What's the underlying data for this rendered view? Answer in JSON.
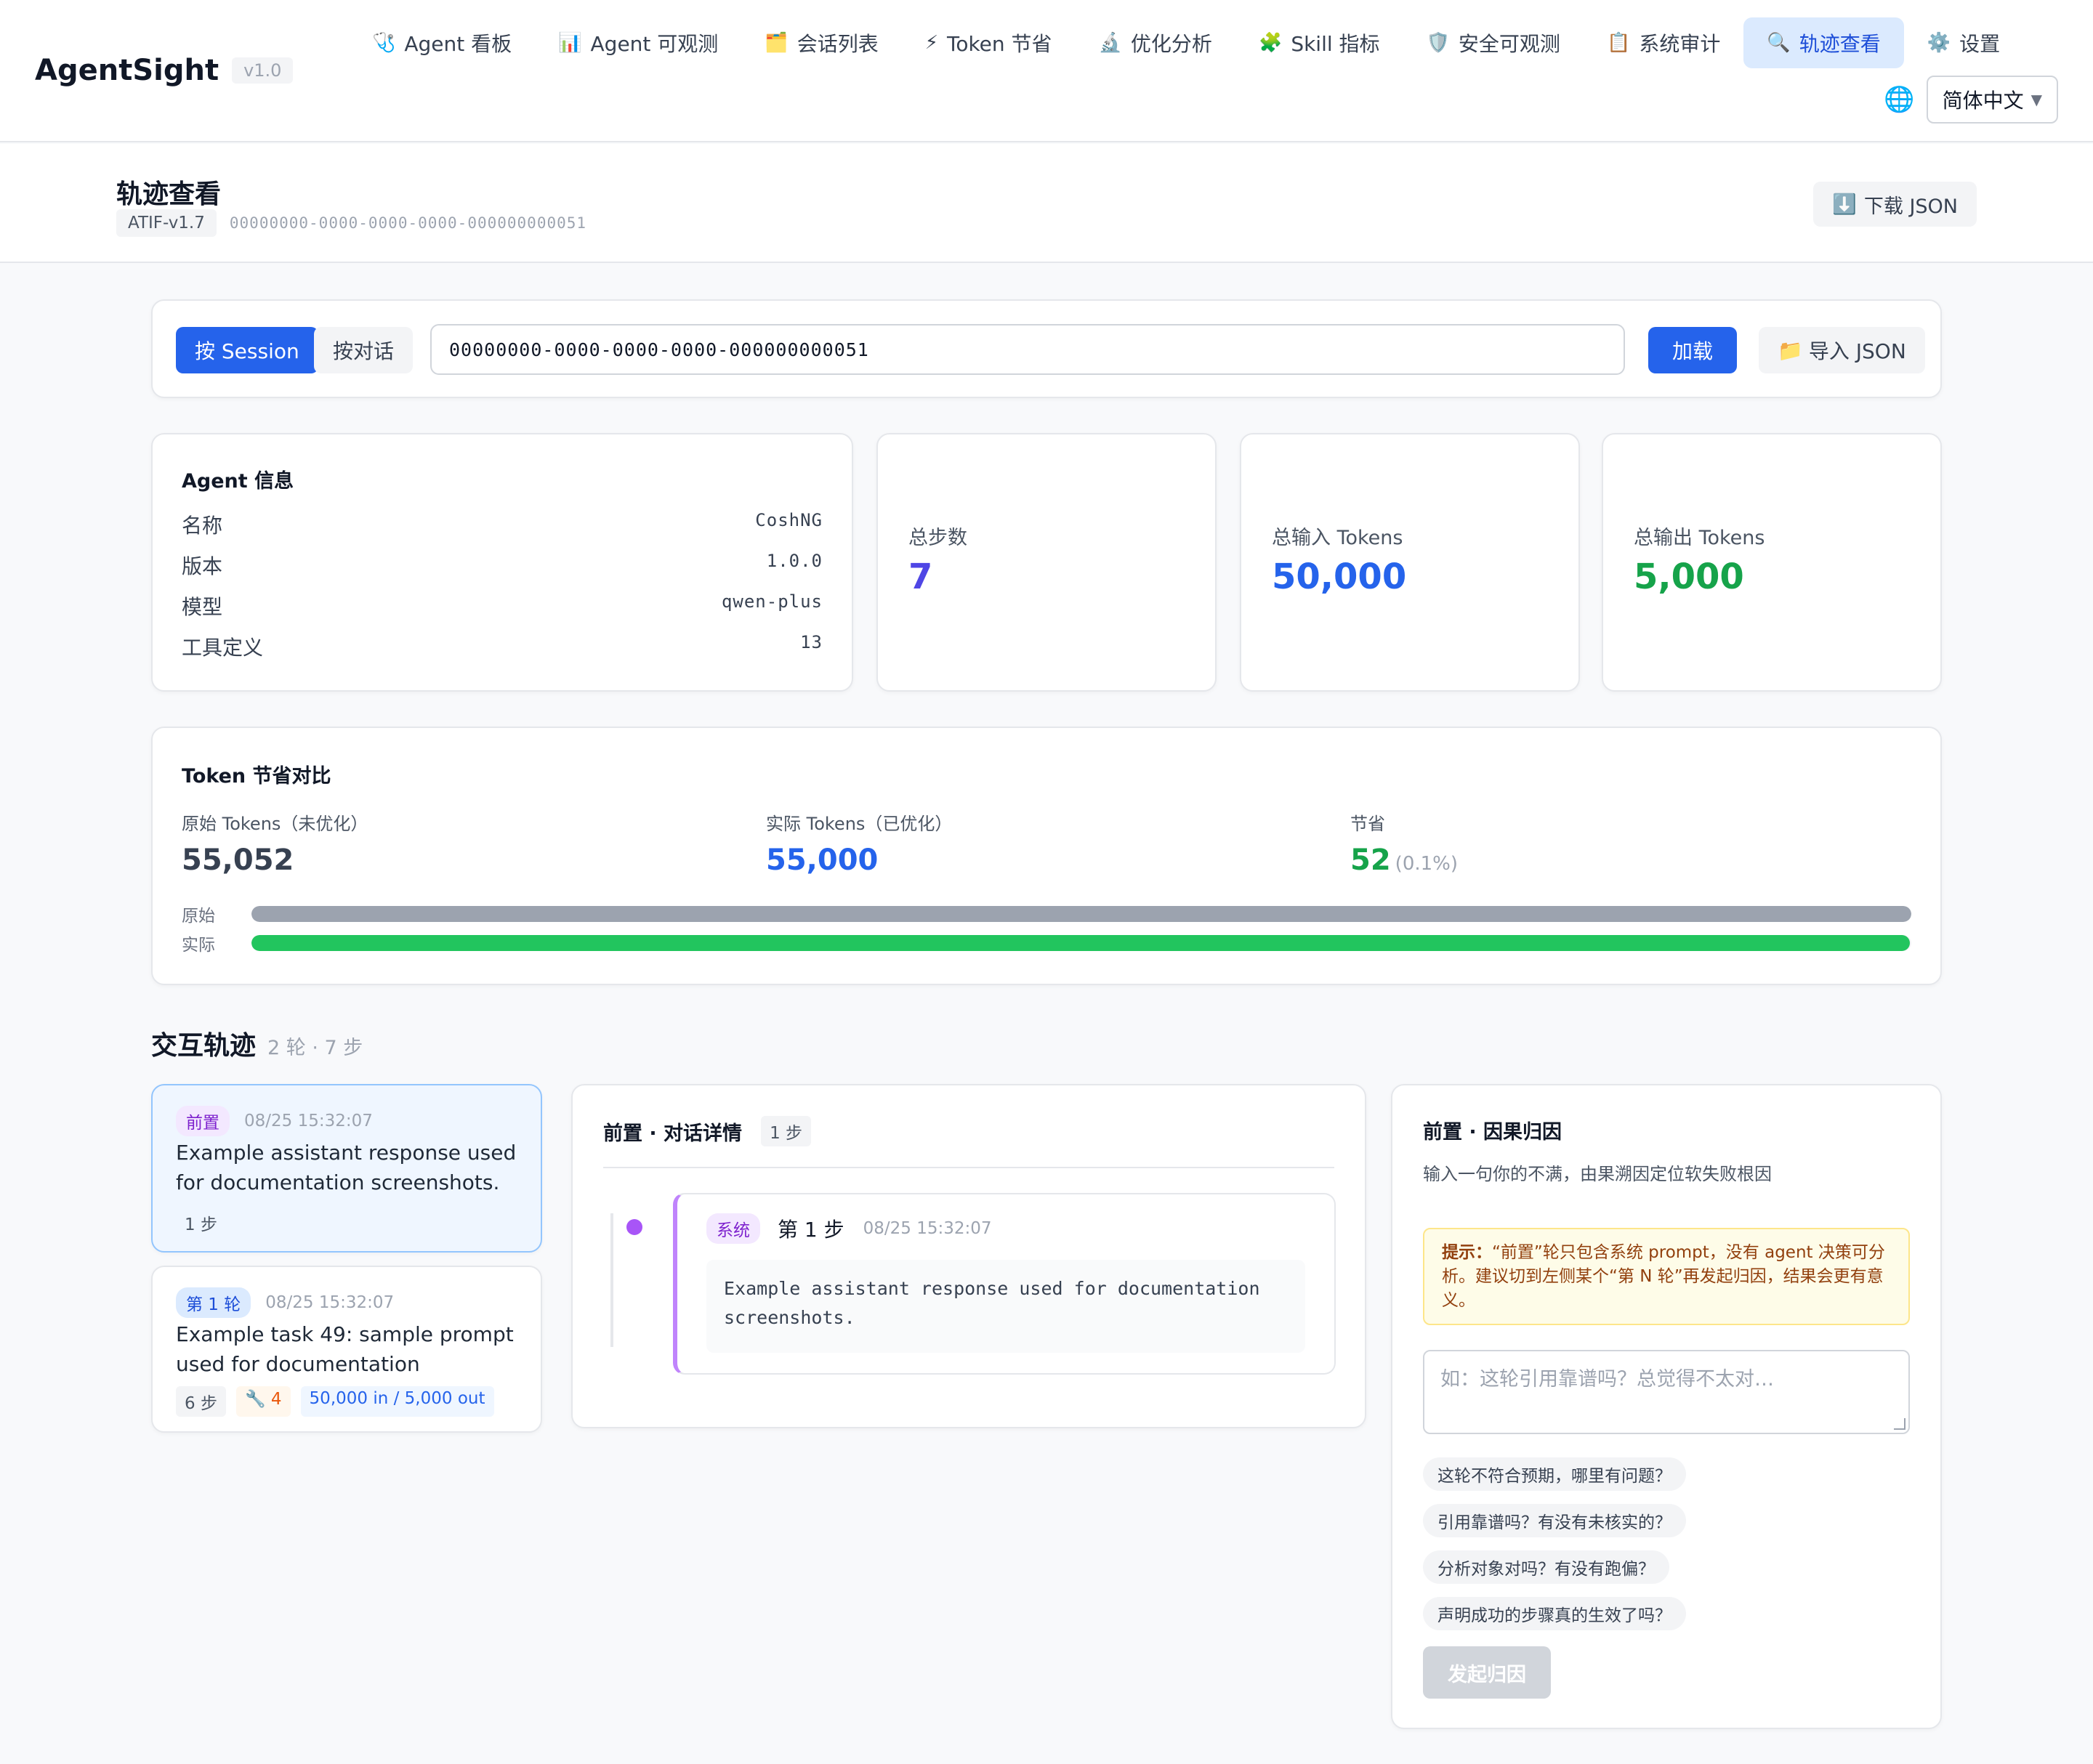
{
  "app": {
    "name": "AgentSight",
    "version": "v1.0"
  },
  "nav": [
    {
      "icon": "🩺",
      "label": "Agent 看板"
    },
    {
      "icon": "📊",
      "label": "Agent 可观测"
    },
    {
      "icon": "🗂️",
      "label": "会话列表"
    },
    {
      "icon": "⚡",
      "label": "Token 节省"
    },
    {
      "icon": "🔬",
      "label": "优化分析"
    },
    {
      "icon": "🧩",
      "label": "Skill 指标"
    },
    {
      "icon": "🛡️",
      "label": "安全可观测"
    },
    {
      "icon": "📋",
      "label": "系统审计"
    },
    {
      "icon": "🔍",
      "label": "轨迹查看",
      "active": true
    },
    {
      "icon": "⚙️",
      "label": "设置"
    }
  ],
  "language": {
    "icon": "🌐",
    "selected": "简体中文"
  },
  "page": {
    "title": "轨迹查看",
    "format_badge": "ATIF-v1.7",
    "session_id": "00000000-0000-0000-0000-000000000051",
    "download_icon": "⬇️",
    "download_label": "下载 JSON"
  },
  "search": {
    "mode_session": "按 Session",
    "mode_dialog": "按对话",
    "input_value": "00000000-0000-0000-0000-000000000051",
    "load_label": "加载",
    "import_icon": "📁",
    "import_label": "导入 JSON"
  },
  "agent_info": {
    "title": "Agent 信息",
    "rows": [
      {
        "key": "名称",
        "value": "CoshNG"
      },
      {
        "key": "版本",
        "value": "1.0.0"
      },
      {
        "key": "模型",
        "value": "qwen-plus"
      },
      {
        "key": "工具定义",
        "value": "13"
      }
    ]
  },
  "stats": [
    {
      "label": "总步数",
      "value": "7",
      "color": "#4f46e5"
    },
    {
      "label": "总输入 Tokens",
      "value": "50,000",
      "color": "#2563eb"
    },
    {
      "label": "总输出 Tokens",
      "value": "5,000",
      "color": "#16a34a"
    }
  ],
  "token_compare": {
    "title": "Token 节省对比",
    "original_label": "原始 Tokens（未优化）",
    "original_value": "55,052",
    "actual_label": "实际 Tokens（已优化）",
    "actual_value": "55,000",
    "saved_label": "节省",
    "saved_value": "52",
    "saved_pct": "(0.1%)",
    "bar_original_label": "原始",
    "bar_actual_label": "实际",
    "original_fraction": 1.0,
    "actual_fraction": 0.999,
    "colors": {
      "original": "#9ca3af",
      "actual": "#22c55e",
      "actual_text": "#2563eb",
      "saved_text": "#16a34a"
    }
  },
  "interactions": {
    "title": "交互轨迹",
    "summary": "2 轮 · 7 步",
    "turns": [
      {
        "tag": "前置",
        "time": "08/25 15:32:07",
        "text": "Example assistant response used for documentation screenshots.",
        "steps": "1 步"
      },
      {
        "tag": "第 1 轮",
        "time": "08/25 15:32:07",
        "text": "Example task 49: sample prompt used for documentation",
        "steps": "6 步",
        "tools": "🔧 4",
        "tokens": "50,000 in / 5,000 out"
      }
    ]
  },
  "detail": {
    "title": "前置 · 对话详情",
    "steps_badge": "1 步",
    "step": {
      "role": "系统",
      "number": "第 1 步",
      "time": "08/25 15:32:07",
      "content": "Example assistant response used for documentation screenshots."
    }
  },
  "cause": {
    "title": "前置 · 因果归因",
    "subtitle": "输入一句你的不满，由果溯因定位软失败根因",
    "hint_label": "提示：",
    "hint_text": "“前置”轮只包含系统 prompt，没有 agent 决策可分析。建议切到左侧某个“第 N 轮”再发起归因，结果会更有意义。",
    "placeholder": "如：这轮引用靠谱吗？总觉得不太对…",
    "suggestions": [
      "这轮不符合预期，哪里有问题？",
      "引用靠谱吗？有没有未核实的？",
      "分析对象对吗？有没有跑偏？",
      "声明成功的步骤真的生效了吗？"
    ],
    "submit_label": "发起归因"
  }
}
